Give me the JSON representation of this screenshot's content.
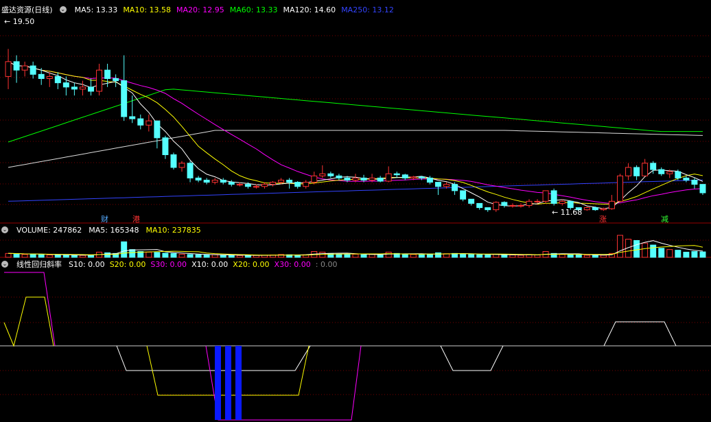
{
  "top_panel": {
    "stock_name": "盛达资源(日线)",
    "ma": [
      {
        "label": "MA5: 13.33",
        "color": "#ffffff"
      },
      {
        "label": "MA10: 13.58",
        "color": "#ffff00"
      },
      {
        "label": "MA20: 12.95",
        "color": "#ff00ff"
      },
      {
        "label": "MA60: 13.33",
        "color": "#00ff00"
      },
      {
        "label": "MA120: 14.60",
        "color": "#ffffff"
      },
      {
        "label": "MA250: 13.12",
        "color": "#3344ff"
      }
    ],
    "high_mark": "19.50",
    "low_mark": "11.68",
    "event_tags": [
      {
        "text": "财",
        "color": "#55aaff"
      },
      {
        "text": "港",
        "color": "#ff3333"
      },
      {
        "text": "涨",
        "color": "#ff3333"
      },
      {
        "text": "减",
        "color": "#33ff33"
      }
    ]
  },
  "volume_panel": {
    "title": "VOLUME: 247862",
    "ma5": "MA5: 165348",
    "ma10": "MA10: 237835"
  },
  "indicator_panel": {
    "title": "线性回归斜率",
    "items": [
      {
        "label": "S10: 0.00",
        "color": "#ffffff"
      },
      {
        "label": "S20: 0.00",
        "color": "#ffff00"
      },
      {
        "label": "S30: 0.00",
        "color": "#ff00ff"
      },
      {
        "label": "X10: 0.00",
        "color": "#ffffff"
      },
      {
        "label": "X20: 0.00",
        "color": "#ffff00"
      },
      {
        "label": "X30: 0.00",
        "color": "#ff00ff"
      },
      {
        "label": ": 0.00",
        "color": "#888888"
      }
    ]
  },
  "colors": {
    "up": "#ff3333",
    "down": "#55ffff",
    "grid": "#7a0000",
    "separator": "#990000",
    "ma5": "#ffffff",
    "ma10": "#ffff00",
    "ma20": "#ff00ff",
    "ma60": "#00ff00",
    "ma120": "#dddddd",
    "ma250": "#3344ff"
  },
  "candles": [
    [
      16.9,
      17.6,
      16.3,
      18.2
    ],
    [
      17.6,
      17.2,
      16.6,
      17.9
    ],
    [
      17.2,
      17.4,
      16.9,
      17.6
    ],
    [
      17.4,
      17.0,
      16.8,
      17.6
    ],
    [
      17.0,
      16.8,
      16.5,
      17.3
    ],
    [
      16.8,
      16.9,
      16.4,
      17.1
    ],
    [
      16.9,
      16.6,
      16.3,
      17.1
    ],
    [
      16.6,
      16.4,
      16.0,
      16.9
    ],
    [
      16.4,
      16.3,
      16.0,
      16.6
    ],
    [
      16.3,
      16.4,
      16.0,
      16.7
    ],
    [
      16.4,
      16.2,
      16.0,
      16.8
    ],
    [
      16.2,
      17.2,
      16.0,
      17.5
    ],
    [
      17.2,
      16.8,
      16.4,
      17.5
    ],
    [
      16.8,
      16.7,
      16.4,
      17.0
    ],
    [
      16.7,
      15.0,
      14.8,
      17.9
    ],
    [
      15.0,
      14.9,
      14.7,
      16.0
    ],
    [
      14.9,
      14.6,
      14.4,
      15.1
    ],
    [
      14.6,
      14.8,
      14.3,
      15.1
    ],
    [
      14.8,
      14.0,
      13.5,
      14.8
    ],
    [
      14.0,
      13.2,
      13.0,
      14.1
    ],
    [
      13.2,
      12.6,
      12.5,
      13.3
    ],
    [
      12.6,
      12.8,
      12.4,
      12.9
    ],
    [
      12.8,
      12.1,
      11.9,
      12.9
    ],
    [
      12.1,
      12.0,
      11.9,
      12.2
    ],
    [
      12.0,
      11.9,
      11.8,
      12.1
    ],
    [
      11.9,
      12.0,
      11.8,
      12.1
    ],
    [
      12.0,
      11.9,
      11.8,
      12.1
    ],
    [
      11.9,
      11.8,
      11.7,
      12.0
    ],
    [
      11.8,
      11.8,
      11.7,
      11.9
    ],
    [
      11.8,
      11.7,
      11.6,
      11.9
    ],
    [
      11.7,
      11.7,
      11.6,
      11.8
    ],
    [
      11.7,
      11.8,
      11.6,
      11.9
    ],
    [
      11.8,
      11.9,
      11.7,
      11.95
    ],
    [
      11.9,
      12.0,
      11.8,
      12.1
    ],
    [
      12.0,
      11.9,
      11.6,
      12.1
    ],
    [
      11.9,
      11.7,
      11.6,
      11.95
    ],
    [
      11.7,
      11.9,
      11.6,
      12.0
    ],
    [
      11.9,
      12.2,
      11.8,
      12.4
    ],
    [
      12.2,
      12.3,
      12.1,
      12.7
    ],
    [
      12.3,
      12.2,
      12.1,
      12.4
    ],
    [
      12.2,
      12.1,
      12.0,
      12.3
    ],
    [
      12.1,
      12.0,
      11.9,
      12.2
    ],
    [
      12.0,
      12.1,
      11.9,
      12.3
    ],
    [
      12.1,
      12.0,
      11.9,
      12.25
    ],
    [
      12.0,
      12.1,
      11.9,
      12.3
    ],
    [
      12.1,
      11.95,
      11.9,
      12.2
    ],
    [
      11.95,
      12.3,
      11.9,
      12.65
    ],
    [
      12.3,
      12.25,
      12.1,
      12.4
    ],
    [
      12.25,
      12.1,
      12.0,
      12.3
    ],
    [
      12.1,
      12.15,
      12.0,
      12.2
    ],
    [
      12.15,
      12.1,
      12.0,
      12.2
    ],
    [
      12.1,
      11.9,
      11.8,
      12.2
    ],
    [
      11.9,
      11.7,
      11.3,
      11.9
    ],
    [
      11.7,
      11.8,
      11.6,
      11.9
    ],
    [
      11.8,
      11.5,
      11.3,
      11.9
    ],
    [
      11.5,
      11.1,
      11.0,
      11.5
    ],
    [
      11.1,
      10.9,
      10.8,
      11.1
    ],
    [
      10.9,
      10.7,
      10.6,
      10.9
    ],
    [
      10.7,
      10.6,
      10.5,
      10.7
    ],
    [
      10.6,
      10.95,
      10.5,
      11.0
    ],
    [
      10.95,
      10.8,
      10.7,
      11.0
    ],
    [
      10.8,
      10.8,
      10.7,
      10.9
    ],
    [
      10.8,
      10.8,
      10.7,
      10.9
    ],
    [
      10.8,
      11.0,
      10.7,
      11.1
    ],
    [
      11.0,
      11.0,
      10.9,
      11.1
    ],
    [
      11.0,
      11.5,
      10.9,
      11.5
    ],
    [
      11.5,
      10.9,
      10.8,
      11.6
    ],
    [
      10.9,
      11.0,
      10.8,
      11.1
    ],
    [
      11.0,
      10.7,
      10.6,
      11.0
    ],
    [
      10.7,
      10.6,
      10.55,
      10.7
    ],
    [
      10.6,
      10.7,
      10.55,
      10.75
    ],
    [
      10.7,
      10.6,
      10.55,
      10.75
    ],
    [
      10.6,
      10.65,
      10.55,
      10.7
    ],
    [
      10.65,
      11.0,
      10.6,
      11.3
    ],
    [
      11.0,
      12.2,
      11.0,
      12.3
    ],
    [
      12.2,
      12.6,
      12.0,
      12.8
    ],
    [
      12.6,
      12.2,
      12.0,
      12.7
    ],
    [
      12.2,
      12.8,
      12.2,
      13.0
    ],
    [
      12.8,
      12.5,
      12.3,
      12.9
    ],
    [
      12.5,
      12.3,
      12.2,
      12.6
    ],
    [
      12.3,
      12.4,
      12.1,
      12.5
    ],
    [
      12.4,
      12.1,
      12.0,
      12.5
    ],
    [
      12.1,
      12.0,
      11.9,
      12.2
    ],
    [
      12.0,
      11.8,
      11.6,
      12.1
    ],
    [
      11.8,
      11.4,
      11.3,
      11.8
    ]
  ],
  "volumes": [
    30,
    28,
    22,
    25,
    20,
    18,
    19,
    17,
    16,
    15,
    18,
    40,
    35,
    30,
    120,
    60,
    45,
    40,
    38,
    32,
    30,
    24,
    22,
    20,
    18,
    20,
    16,
    15,
    14,
    16,
    15,
    16,
    18,
    22,
    20,
    18,
    20,
    45,
    40,
    30,
    25,
    22,
    24,
    20,
    22,
    18,
    40,
    30,
    25,
    22,
    20,
    26,
    35,
    28,
    30,
    26,
    22,
    20,
    18,
    24,
    20,
    18,
    16,
    22,
    18,
    45,
    30,
    22,
    20,
    18,
    16,
    18,
    16,
    30,
    170,
    140,
    130,
    110,
    95,
    70,
    60,
    55,
    40,
    45,
    42
  ]
}
